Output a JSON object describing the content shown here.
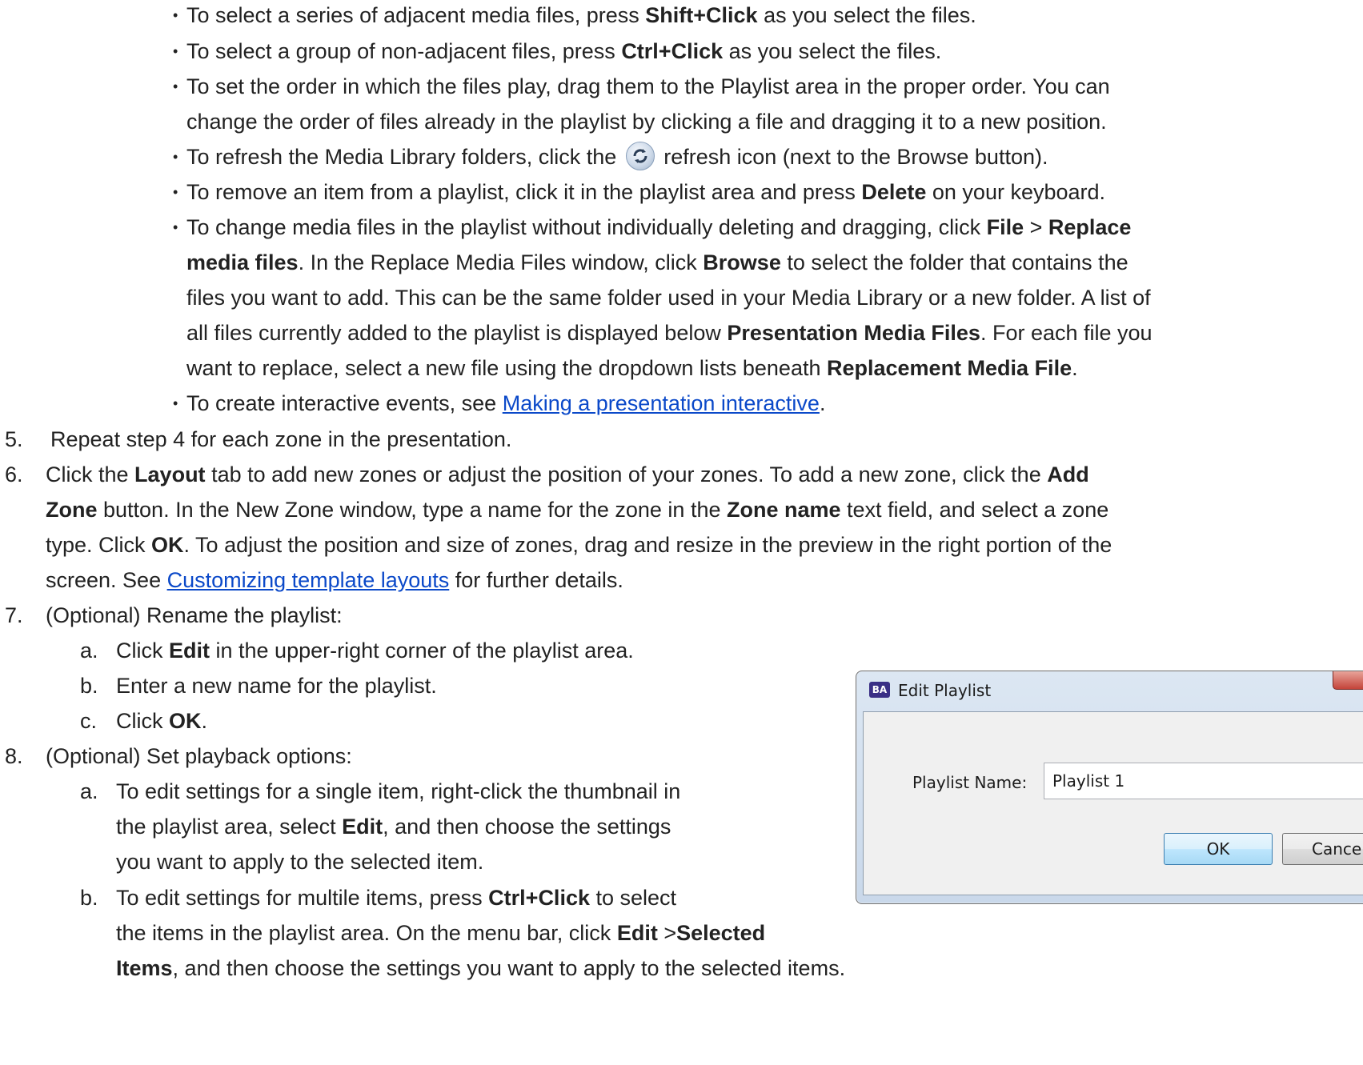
{
  "bullets": {
    "b1": {
      "pre": "To select a series of adjacent media files, press ",
      "bold": "Shift+Click",
      "post": " as you select the files."
    },
    "b2": {
      "pre": "To select a group of non-adjacent files, press ",
      "bold": "Ctrl+Click",
      "post": " as you select the files."
    },
    "b3": {
      "l1": "To set the order in which the files play, drag them to the Playlist area in the proper order. You can",
      "l2": "change the order of files already in the playlist by clicking a file and dragging it to a new position."
    },
    "b4": {
      "pre": "To refresh the Media Library folders, click the ",
      "post": " refresh icon (next to the Browse button)."
    },
    "b5": {
      "pre": "To remove an item from a playlist, click it in the playlist area and press ",
      "bold": "Delete",
      "post": " on your keyboard."
    },
    "b6": {
      "l1_pre": "To change media files in the playlist without individually deleting and dragging, click ",
      "l1_b1": "File",
      "l1_mid": " > ",
      "l1_b2": "Replace",
      "l2_b": "media files",
      "l2_mid": ". In the Replace Media Files window, click ",
      "l2_b2": "Browse",
      "l2_post": " to select the folder that contains the",
      "l3": "files you want to add. This can be the same folder used in your Media Library or a new folder. A list of",
      "l4_pre": "all files currently added to the playlist is displayed below ",
      "l4_b": "Presentation Media Files",
      "l4_post": ". For each file you",
      "l5_pre": "want to replace, select a new file using the dropdown lists beneath ",
      "l5_b": "Replacement Media File",
      "l5_post": "."
    },
    "b7": {
      "pre": "To create interactive events, see ",
      "link": "Making a presentation interactive",
      "post": "."
    }
  },
  "steps": {
    "s5": {
      "num": "5.",
      "text": "Repeat step 4 for each zone in the presentation."
    },
    "s6": {
      "num": "6.",
      "l1_pre": "Click the ",
      "l1_b1": "Layout",
      "l1_mid": " tab to add new zones or adjust the position of your zones. To add a new zone, click the ",
      "l1_b2": "Add",
      "l2_b1": "Zone",
      "l2_mid": " button. In the New Zone window, type a name for the zone in the ",
      "l2_b2": "Zone name",
      "l2_post": " text field, and select a zone",
      "l3_pre": "type. Click ",
      "l3_b": "OK",
      "l3_post": ". To adjust the position and size of zones, drag and resize in the preview in the right portion of the",
      "l4_pre": "screen. See ",
      "l4_link": "Customizing template layouts",
      "l4_post": " for further details."
    },
    "s7": {
      "num": "7.",
      "text": "(Optional) Rename the playlist:",
      "a": {
        "label": "a.",
        "pre": "Click ",
        "bold": "Edit",
        "post": " in the upper-right corner of the playlist area."
      },
      "b": {
        "label": "b.",
        "text": "Enter a new name for the playlist."
      },
      "c": {
        "label": "c.",
        "pre": "Click ",
        "bold": "OK",
        "post": "."
      }
    },
    "s8": {
      "num": "8.",
      "text": "(Optional) Set playback options:",
      "a": {
        "label": "a.",
        "l1": "To edit settings for a single item, right-click the thumbnail in",
        "l2_pre": "the playlist area, select ",
        "l2_b": "Edit",
        "l2_post": ", and then choose the settings",
        "l3": "you want to apply to the selected item."
      },
      "b": {
        "label": "b.",
        "l1_pre": "To edit settings for multile items, press ",
        "l1_b": "Ctrl+Click",
        "l1_post": " to select",
        "l2_pre": "the items in the playlist area. On the menu bar, click ",
        "l2_b1": "Edit",
        "l2_mid": " >",
        "l2_b2": "Selected",
        "l3_b": "Items",
        "l3_post": ", and then choose the settings you want to apply to the selected items."
      }
    }
  },
  "dialog": {
    "app_icon": "BA",
    "title": "Edit Playlist",
    "field_label": "Playlist Name:",
    "field_value": "Playlist 1",
    "ok_label": "OK",
    "cancel_label": "Cancel"
  },
  "bullet_glyph": "•",
  "colors": {
    "link": "#0b49c9",
    "text": "#222222"
  }
}
